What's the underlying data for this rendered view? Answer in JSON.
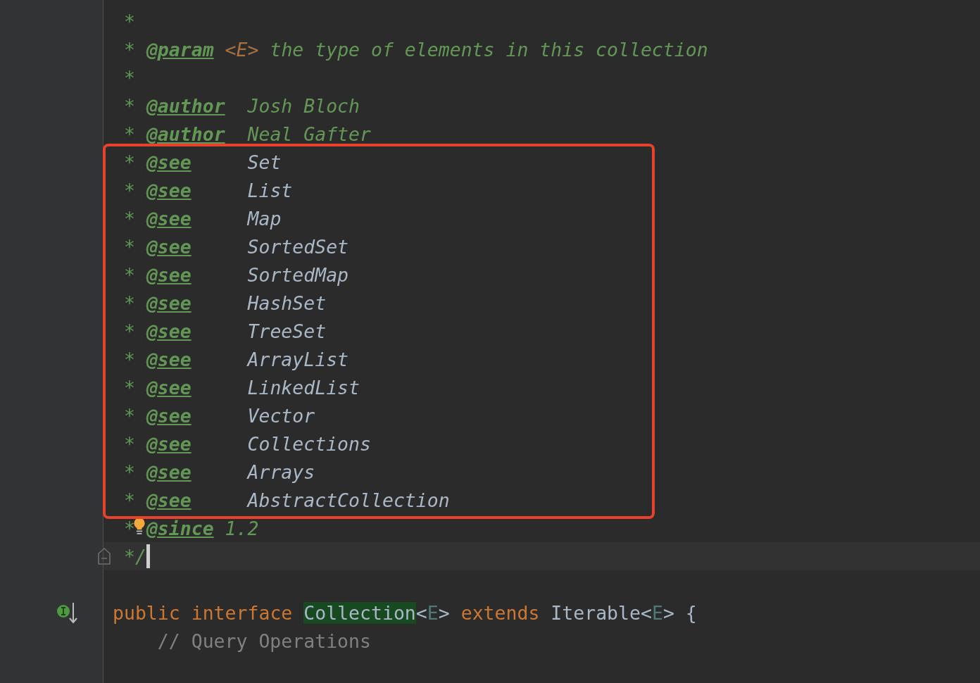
{
  "javadoc": {
    "blocks": [
      {
        "framed": false,
        "lines": [
          {
            "kind": "star",
            "star": "*"
          },
          {
            "kind": "tag_inline",
            "star": "*",
            "tag": "@param",
            "type_param": "<E>",
            "text": "the type of elements in this collection"
          },
          {
            "kind": "star",
            "star": "*"
          },
          {
            "kind": "tag_aligned",
            "star": "*",
            "tag": "@author",
            "text": "Josh Bloch"
          },
          {
            "kind": "tag_aligned",
            "star": "*",
            "tag": "@author",
            "text": "Neal Gafter"
          }
        ]
      },
      {
        "framed": true,
        "lines": [
          {
            "kind": "see",
            "star": "*",
            "tag": "@see",
            "text": "Set"
          },
          {
            "kind": "see",
            "star": "*",
            "tag": "@see",
            "text": "List"
          },
          {
            "kind": "see",
            "star": "*",
            "tag": "@see",
            "text": "Map"
          },
          {
            "kind": "see",
            "star": "*",
            "tag": "@see",
            "text": "SortedSet"
          },
          {
            "kind": "see",
            "star": "*",
            "tag": "@see",
            "text": "SortedMap"
          },
          {
            "kind": "see",
            "star": "*",
            "tag": "@see",
            "text": "HashSet"
          },
          {
            "kind": "see",
            "star": "*",
            "tag": "@see",
            "text": "TreeSet"
          },
          {
            "kind": "see",
            "star": "*",
            "tag": "@see",
            "text": "ArrayList"
          },
          {
            "kind": "see",
            "star": "*",
            "tag": "@see",
            "text": "LinkedList"
          },
          {
            "kind": "see",
            "star": "*",
            "tag": "@see",
            "text": "Vector"
          },
          {
            "kind": "see",
            "star": "*",
            "tag": "@see",
            "text": "Collections"
          },
          {
            "kind": "see",
            "star": "*",
            "tag": "@see",
            "text": "Arrays"
          },
          {
            "kind": "see",
            "star": "*",
            "tag": "@see",
            "text": "AbstractCollection"
          }
        ]
      },
      {
        "framed": false,
        "lines": [
          {
            "kind": "tag_inline",
            "star": "*",
            "tag": "@since",
            "text": "1.2",
            "bulb": true
          },
          {
            "kind": "close",
            "text": "*/",
            "current": true
          }
        ]
      }
    ]
  },
  "declaration": {
    "words": [
      [
        {
          "kind": "keyword",
          "text": "public"
        }
      ],
      [
        {
          "kind": "keyword",
          "text": "interface"
        }
      ],
      [
        {
          "kind": "match",
          "text": "Collection"
        },
        {
          "kind": "punct",
          "text": "<"
        },
        {
          "kind": "type_param",
          "text": "E"
        },
        {
          "kind": "punct",
          "text": ">"
        }
      ],
      [
        {
          "kind": "keyword",
          "text": "extends"
        }
      ],
      [
        {
          "kind": "class",
          "text": "Iterable"
        },
        {
          "kind": "punct",
          "text": "<"
        },
        {
          "kind": "type_param",
          "text": "E"
        },
        {
          "kind": "punct",
          "text": ">"
        }
      ],
      [
        {
          "kind": "punct",
          "text": "{"
        }
      ]
    ]
  },
  "member_comment": "// Query Operations"
}
